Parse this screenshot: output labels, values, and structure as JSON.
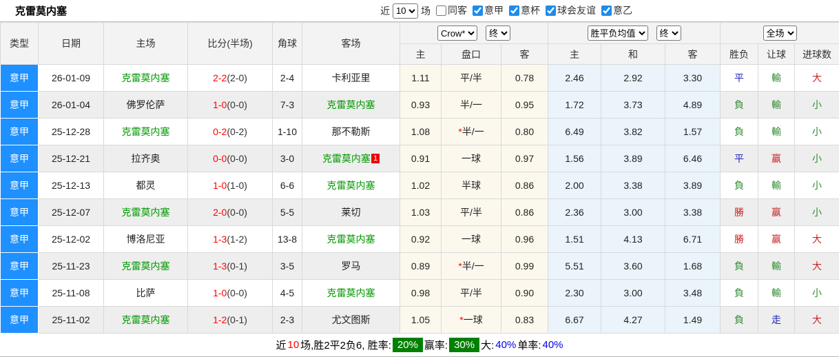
{
  "title": "克雷莫内塞",
  "topbar": {
    "recent_prefix": "近",
    "recent_value": "10",
    "recent_suffix": "场",
    "filters": [
      {
        "label": "同客",
        "checked": false
      },
      {
        "label": "意甲",
        "checked": true
      },
      {
        "label": "意杯",
        "checked": true
      },
      {
        "label": "球会友谊",
        "checked": true
      },
      {
        "label": "意乙",
        "checked": true
      }
    ]
  },
  "table": {
    "left_headers": [
      "类型",
      "日期",
      "主场",
      "比分(半场)",
      "角球",
      "客场"
    ],
    "groups": [
      {
        "dropdowns": [
          "Crow*",
          "终"
        ],
        "cols": [
          "主",
          "盘口",
          "客"
        ]
      },
      {
        "dropdowns": [
          "胜平负均值",
          "终"
        ],
        "cols": [
          "主",
          "和",
          "客"
        ]
      },
      {
        "dropdowns": [
          "全场"
        ],
        "cols": [
          "胜负",
          "让球",
          "进球数"
        ]
      }
    ],
    "subject_team": "克雷莫内塞",
    "rows": [
      {
        "league": "意甲",
        "date": "26-01-09",
        "home": "克雷莫内塞",
        "home_is_subject": true,
        "score": "2-2",
        "half": "(2-0)",
        "corners": "2-4",
        "away": "卡利亚里",
        "away_is_subject": false,
        "away_badge": "",
        "ah_home": "1.11",
        "ah_line": "平/半",
        "ah_away": "0.78",
        "eu_home": "2.46",
        "eu_draw": "2.92",
        "eu_away": "3.30",
        "r_wdl": "平",
        "r_wdl_c": "blue",
        "r_ah": "輸",
        "r_ah_c": "green",
        "r_ou": "大",
        "r_ou_c": "red"
      },
      {
        "league": "意甲",
        "date": "26-01-04",
        "home": "佛罗伦萨",
        "home_is_subject": false,
        "score": "1-0",
        "half": "(0-0)",
        "corners": "7-3",
        "away": "克雷莫内塞",
        "away_is_subject": true,
        "away_badge": "",
        "ah_home": "0.93",
        "ah_line": "半/一",
        "ah_away": "0.95",
        "eu_home": "1.72",
        "eu_draw": "3.73",
        "eu_away": "4.89",
        "r_wdl": "負",
        "r_wdl_c": "green",
        "r_ah": "輸",
        "r_ah_c": "green",
        "r_ou": "小",
        "r_ou_c": "green"
      },
      {
        "league": "意甲",
        "date": "25-12-28",
        "home": "克雷莫内塞",
        "home_is_subject": true,
        "score": "0-2",
        "half": "(0-2)",
        "corners": "1-10",
        "away": "那不勒斯",
        "away_is_subject": false,
        "away_badge": "",
        "ah_home": "1.08",
        "ah_line": "*半/一",
        "ah_away": "0.80",
        "eu_home": "6.49",
        "eu_draw": "3.82",
        "eu_away": "1.57",
        "r_wdl": "負",
        "r_wdl_c": "green",
        "r_ah": "輸",
        "r_ah_c": "green",
        "r_ou": "小",
        "r_ou_c": "green"
      },
      {
        "league": "意甲",
        "date": "25-12-21",
        "home": "拉齐奥",
        "home_is_subject": false,
        "score": "0-0",
        "half": "(0-0)",
        "corners": "3-0",
        "away": "克雷莫内塞",
        "away_is_subject": true,
        "away_badge": "1",
        "ah_home": "0.91",
        "ah_line": "一球",
        "ah_away": "0.97",
        "eu_home": "1.56",
        "eu_draw": "3.89",
        "eu_away": "6.46",
        "r_wdl": "平",
        "r_wdl_c": "blue",
        "r_ah": "赢",
        "r_ah_c": "red",
        "r_ou": "小",
        "r_ou_c": "green"
      },
      {
        "league": "意甲",
        "date": "25-12-13",
        "home": "都灵",
        "home_is_subject": false,
        "score": "1-0",
        "half": "(1-0)",
        "corners": "6-6",
        "away": "克雷莫内塞",
        "away_is_subject": true,
        "away_badge": "",
        "ah_home": "1.02",
        "ah_line": "半球",
        "ah_away": "0.86",
        "eu_home": "2.00",
        "eu_draw": "3.38",
        "eu_away": "3.89",
        "r_wdl": "負",
        "r_wdl_c": "green",
        "r_ah": "輸",
        "r_ah_c": "green",
        "r_ou": "小",
        "r_ou_c": "green"
      },
      {
        "league": "意甲",
        "date": "25-12-07",
        "home": "克雷莫内塞",
        "home_is_subject": true,
        "score": "2-0",
        "half": "(0-0)",
        "corners": "5-5",
        "away": "莱切",
        "away_is_subject": false,
        "away_badge": "",
        "ah_home": "1.03",
        "ah_line": "平/半",
        "ah_away": "0.86",
        "eu_home": "2.36",
        "eu_draw": "3.00",
        "eu_away": "3.38",
        "r_wdl": "勝",
        "r_wdl_c": "red",
        "r_ah": "赢",
        "r_ah_c": "red",
        "r_ou": "小",
        "r_ou_c": "green"
      },
      {
        "league": "意甲",
        "date": "25-12-02",
        "home": "博洛尼亚",
        "home_is_subject": false,
        "score": "1-3",
        "half": "(1-2)",
        "corners": "13-8",
        "away": "克雷莫内塞",
        "away_is_subject": true,
        "away_badge": "",
        "ah_home": "0.92",
        "ah_line": "一球",
        "ah_away": "0.96",
        "eu_home": "1.51",
        "eu_draw": "4.13",
        "eu_away": "6.71",
        "r_wdl": "勝",
        "r_wdl_c": "red",
        "r_ah": "赢",
        "r_ah_c": "red",
        "r_ou": "大",
        "r_ou_c": "red"
      },
      {
        "league": "意甲",
        "date": "25-11-23",
        "home": "克雷莫内塞",
        "home_is_subject": true,
        "score": "1-3",
        "half": "(0-1)",
        "corners": "3-5",
        "away": "罗马",
        "away_is_subject": false,
        "away_badge": "",
        "ah_home": "0.89",
        "ah_line": "*半/一",
        "ah_away": "0.99",
        "eu_home": "5.51",
        "eu_draw": "3.60",
        "eu_away": "1.68",
        "r_wdl": "負",
        "r_wdl_c": "green",
        "r_ah": "輸",
        "r_ah_c": "green",
        "r_ou": "大",
        "r_ou_c": "red"
      },
      {
        "league": "意甲",
        "date": "25-11-08",
        "home": "比萨",
        "home_is_subject": false,
        "score": "1-0",
        "half": "(0-0)",
        "corners": "4-5",
        "away": "克雷莫内塞",
        "away_is_subject": true,
        "away_badge": "",
        "ah_home": "0.98",
        "ah_line": "平/半",
        "ah_away": "0.90",
        "eu_home": "2.30",
        "eu_draw": "3.00",
        "eu_away": "3.48",
        "r_wdl": "負",
        "r_wdl_c": "green",
        "r_ah": "輸",
        "r_ah_c": "green",
        "r_ou": "小",
        "r_ou_c": "green"
      },
      {
        "league": "意甲",
        "date": "25-11-02",
        "home": "克雷莫内塞",
        "home_is_subject": true,
        "score": "1-2",
        "half": "(0-1)",
        "corners": "2-3",
        "away": "尤文图斯",
        "away_is_subject": false,
        "away_badge": "",
        "ah_home": "1.05",
        "ah_line": "*一球",
        "ah_away": "0.83",
        "eu_home": "6.67",
        "eu_draw": "4.27",
        "eu_away": "1.49",
        "r_wdl": "負",
        "r_wdl_c": "green",
        "r_ah": "走",
        "r_ah_c": "blue",
        "r_ou": "大",
        "r_ou_c": "red"
      }
    ]
  },
  "footer": {
    "segments": [
      {
        "t": "近",
        "s": "plain"
      },
      {
        "t": "10",
        "s": "red"
      },
      {
        "t": "场,胜2平2负6, 胜率:",
        "s": "plain"
      },
      {
        "t": "20%",
        "s": "badge"
      },
      {
        "t": "赢率:",
        "s": "plain"
      },
      {
        "t": "30%",
        "s": "badge"
      },
      {
        "t": "大:",
        "s": "plain"
      },
      {
        "t": "40%",
        "s": "blue"
      },
      {
        "t": " 单率:",
        "s": "plain"
      },
      {
        "t": "40%",
        "s": "blue"
      }
    ]
  },
  "colors": {
    "league_cell_bg": "#1e90ff",
    "subject_team_green": "#009900",
    "score_red": "#ff0000",
    "result_win_red": "#cc2222",
    "result_lose_green": "#2e8b2e",
    "result_draw_blue": "#2323bb",
    "asian_cols_bg": "#fcf8ee",
    "euro_cols_bg": "#eaf4fa",
    "stripe_bg": "#eeeeee",
    "footer_badge_green": "#008000",
    "footer_value_blue": "#0000ee",
    "checkbox_blue": "#1b8ceb",
    "red_card_badge": "#ee0000"
  }
}
